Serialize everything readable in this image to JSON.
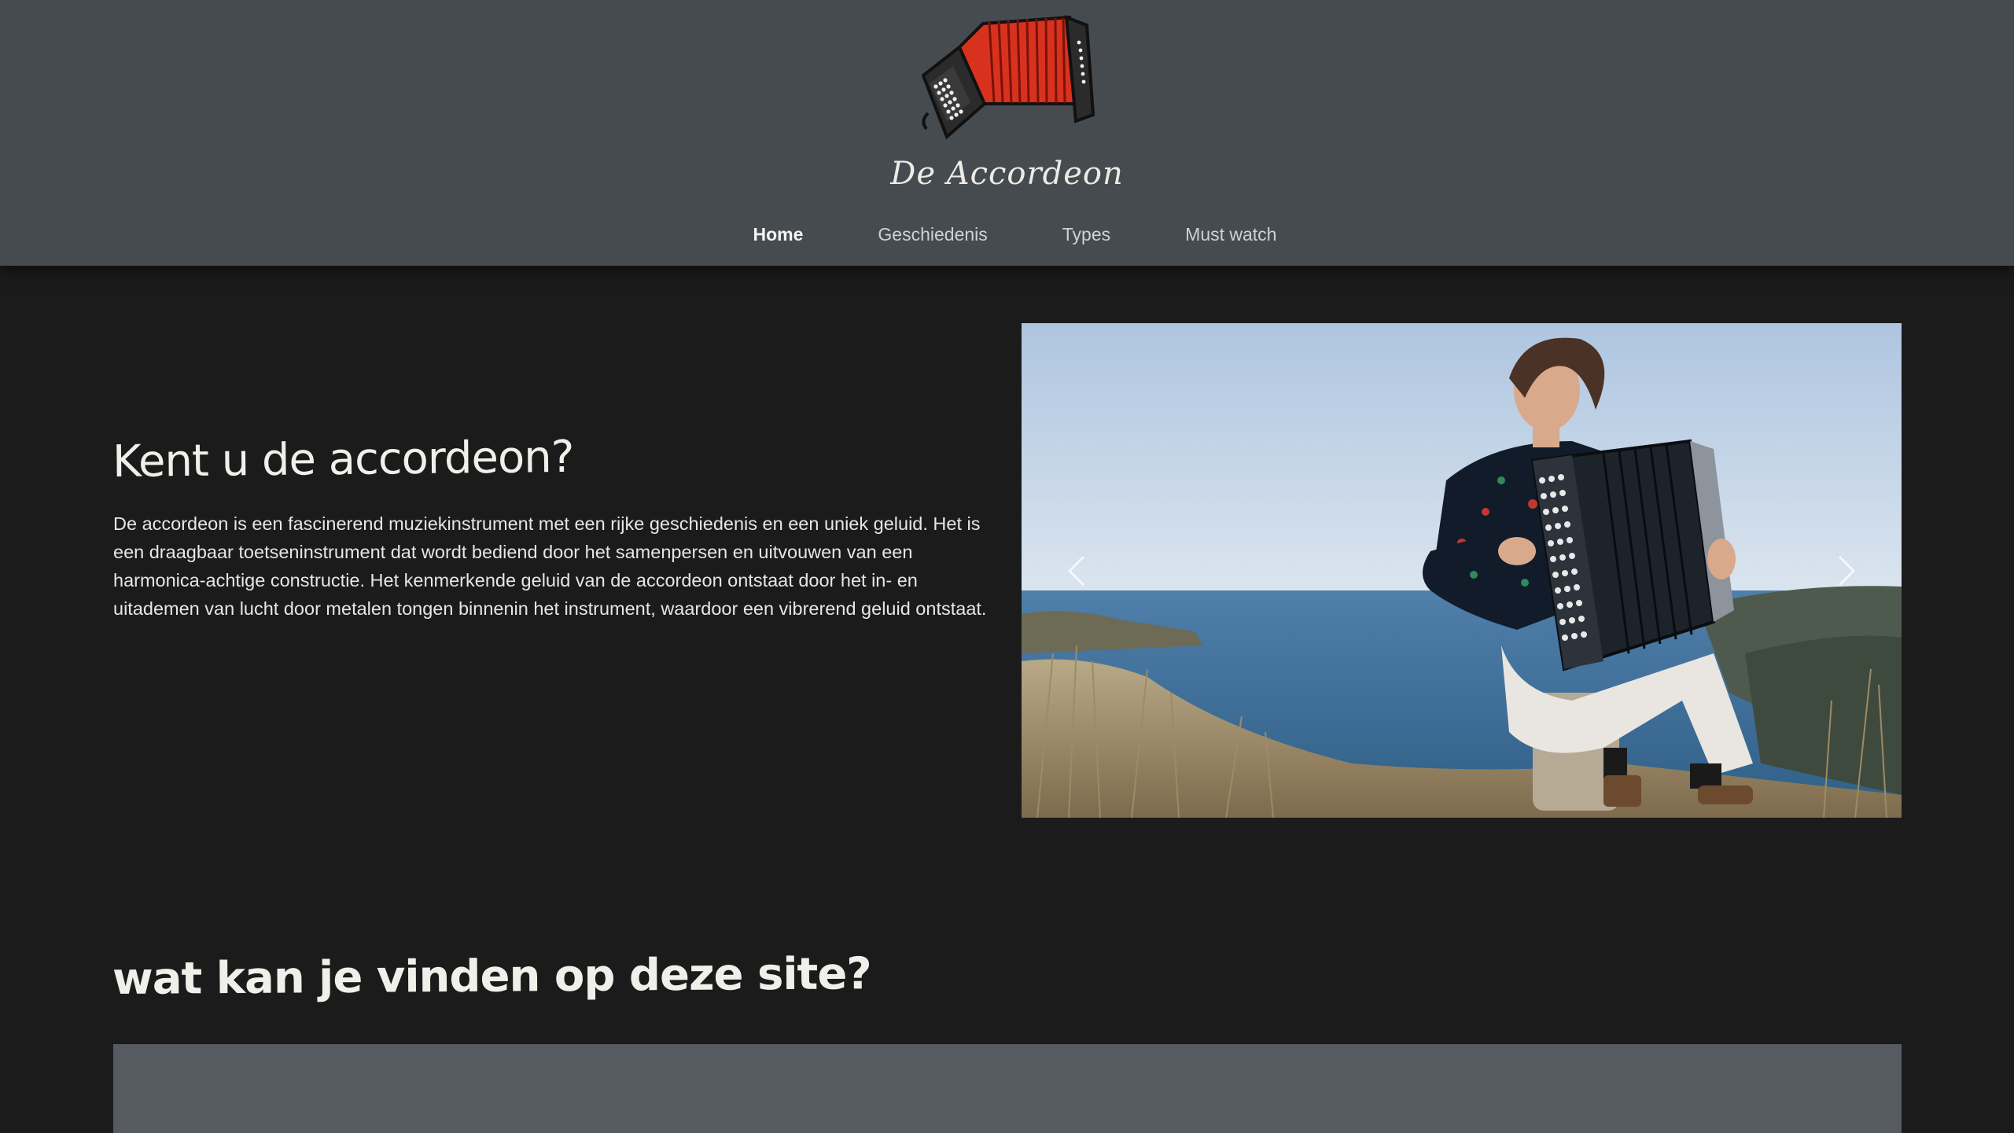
{
  "header": {
    "brand_name": "De Accordeon",
    "logo_icon": "accordion-logo-icon",
    "nav": [
      {
        "label": "Home",
        "active": true
      },
      {
        "label": "Geschiedenis",
        "active": false
      },
      {
        "label": "Types",
        "active": false
      },
      {
        "label": "Must watch",
        "active": false
      }
    ]
  },
  "intro": {
    "title": "Kent u de accordeon?",
    "text": "De accordeon is een fascinerend muziekinstrument met een rijke geschiedenis en een uniek geluid. Het is een draagbaar toetseninstrument dat wordt bediend door het samenpersen en uitvouwen van een harmonica-achtige constructie. Het kenmerkende geluid van de accordeon ontstaat door het in- en uitademen van lucht door metalen tongen binnenin het instrument, waardoor een vibrerend geluid ontstaat."
  },
  "carousel": {
    "prev_icon": "chevron-left-icon",
    "next_icon": "chevron-right-icon"
  },
  "section2": {
    "title": "wat kan je vinden op deze site?"
  },
  "colors": {
    "header_bg": "#464b50",
    "page_bg": "#1b1b1c",
    "accent_red": "#d8321f",
    "panel_bg": "#565b61"
  }
}
